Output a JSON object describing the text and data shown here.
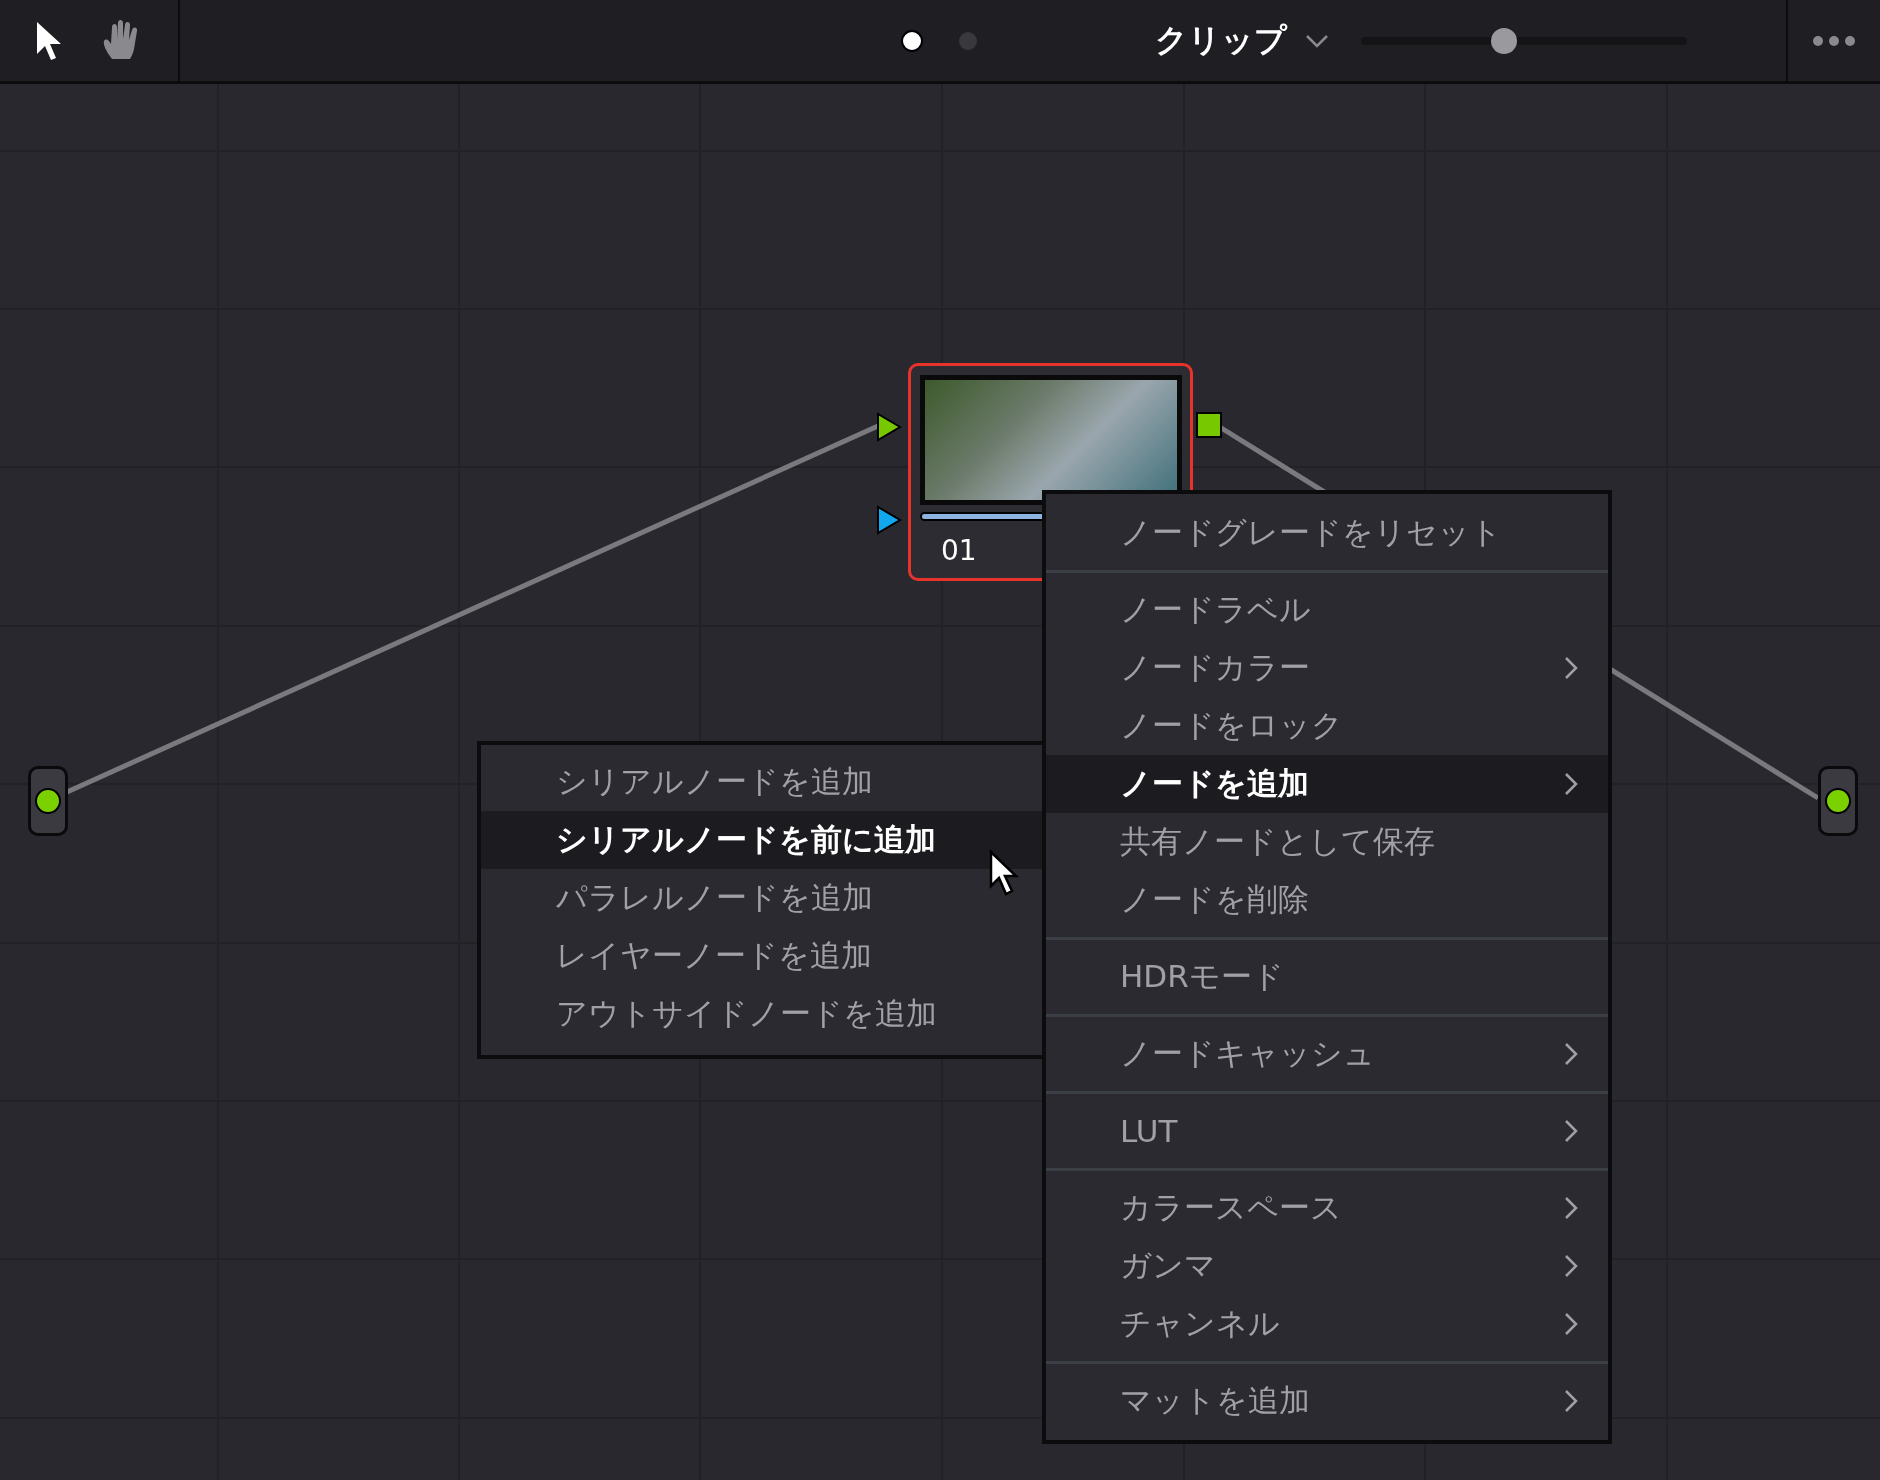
{
  "toolbar": {
    "tools": [
      {
        "kind": "pointer",
        "selected": true
      },
      {
        "kind": "hand",
        "selected": false
      }
    ],
    "page_dots": [
      {
        "selected": true
      },
      {
        "selected": false
      }
    ],
    "mode": {
      "label": "クリップ"
    },
    "zoom_slider": {
      "level": 0.44
    }
  },
  "node": {
    "label": "01",
    "progress": {
      "level": 1
    }
  },
  "context_menu": {
    "sections": [
      [
        {
          "label": "ノードグレードをリセット",
          "submenu": false,
          "selected": false
        }
      ],
      [
        {
          "label": "ノードラベル",
          "submenu": false,
          "selected": false
        },
        {
          "label": "ノードカラー",
          "submenu": true,
          "selected": false
        },
        {
          "label": "ノードをロック",
          "submenu": false,
          "selected": false
        },
        {
          "label": "ノードを追加",
          "submenu": true,
          "selected": true
        },
        {
          "label": "共有ノードとして保存",
          "submenu": false,
          "selected": false
        },
        {
          "label": "ノードを削除",
          "submenu": false,
          "selected": false
        }
      ],
      [
        {
          "label": "HDRモード",
          "submenu": false,
          "selected": false
        }
      ],
      [
        {
          "label": "ノードキャッシュ",
          "submenu": true,
          "selected": false
        }
      ],
      [
        {
          "label": "LUT",
          "submenu": true,
          "selected": false
        }
      ],
      [
        {
          "label": "カラースペース",
          "submenu": true,
          "selected": false
        },
        {
          "label": "ガンマ",
          "submenu": true,
          "selected": false
        },
        {
          "label": "チャンネル",
          "submenu": true,
          "selected": false
        }
      ],
      [
        {
          "label": "マットを追加",
          "submenu": true,
          "selected": false
        }
      ]
    ]
  },
  "submenu": {
    "items": [
      {
        "label": "シリアルノードを追加",
        "selected": false
      },
      {
        "label": "シリアルノードを前に追加",
        "selected": true
      },
      {
        "label": "パラレルノードを追加",
        "selected": false
      },
      {
        "label": "レイヤーノードを追加",
        "selected": false
      },
      {
        "label": "アウトサイドノードを追加",
        "selected": false
      }
    ]
  }
}
